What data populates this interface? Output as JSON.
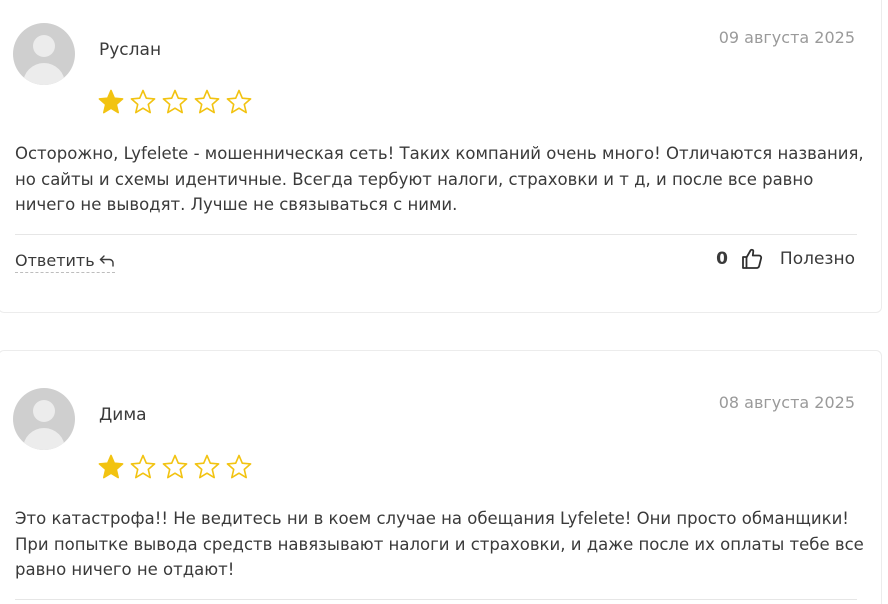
{
  "reviews": [
    {
      "author": "Руслан",
      "date": "09 августа 2025",
      "rating": 1,
      "max_rating": 5,
      "text": "Осторожно, Lyfelete - мошенническая сеть! Таких компаний очень много! Отличаются названия, но сайты и схемы идентичные. Всегда тербуют налоги, страховки и т д, и после все равно ничего не выводят. Лучше не связываться с ними.",
      "reply_label": "Ответить",
      "helpful_count": "0",
      "helpful_label": "Полезно"
    },
    {
      "author": "Дима",
      "date": "08 августа 2025",
      "rating": 1,
      "max_rating": 5,
      "text": "Это катастрофа!! Не ведитесь ни в коем случае на обещания Lyfelete! Они просто обманщики! При попытке вывода средств навязывают налоги и страховки, и даже после их оплаты тебе все равно ничего не отдают!"
    }
  ],
  "icons": {
    "avatar": "user-placeholder-icon",
    "star_filled": "star-filled-icon",
    "star_empty": "star-outline-icon",
    "reply": "reply-arrow-icon",
    "thumb": "thumbs-up-icon"
  },
  "colors": {
    "star": "#f2c311",
    "text": "#3a3a3a",
    "date": "#9a9a9a",
    "avatar_bg": "#cfcfcf"
  }
}
